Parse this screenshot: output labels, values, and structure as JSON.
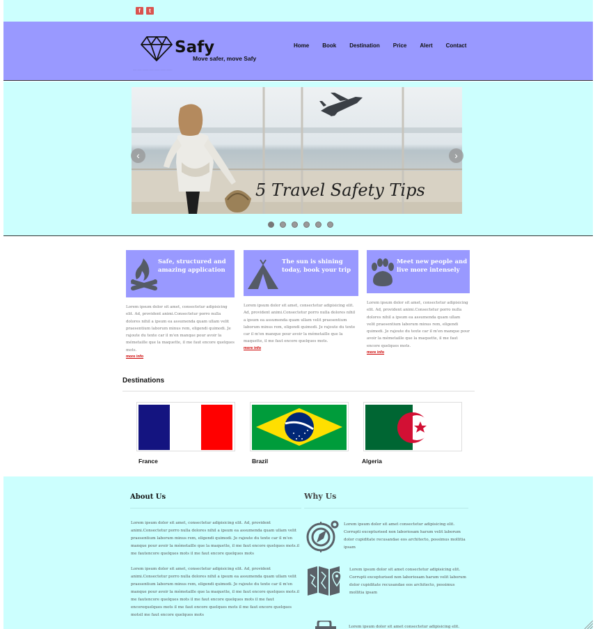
{
  "social": {
    "facebook": "f",
    "twitter": "t"
  },
  "header": {
    "logo": "Safy",
    "tagline": "Move safer, move Safy",
    "tiny_line": "..................................................",
    "nav": [
      "Home",
      "Book",
      "Destination",
      "Price",
      "Alert",
      "Contact"
    ]
  },
  "hero": {
    "slide_text": "5 Travel Safety Tips",
    "slide_count": 6,
    "active_slide": 1
  },
  "features": [
    {
      "icon": "campfire-icon",
      "title": "Safe, structured and amazing application",
      "body": "Lorem ipsum dolor sit amet, consectetur adipisicing elit. Ad, provident animi.Consectetur porro nulla dolores nihil a ipsum ea assumenda quam ullam velit praesentium laborum minus rem, eligendi quimodi. Je rajoute du texte car il m'en manque pour avoir la mémetaille que la maquette, il me faut encore quelques mots.",
      "more": "more info"
    },
    {
      "icon": "tent-icon",
      "title": "The sun is shining today, book your trip",
      "body": "Lorem ipsum dolor sit amet, consectetur adipisicing elit. Ad, provident animi.Consectetur porro nulla dolores nihil a ipsum ea assumenda quam ullam velit praesentium laborum minus rem, eligendi quimodi. Je rajoute du texte car il m'en manque pour avoir la mémetaille que la maquette, il me faut encore quelques mots.",
      "more": "more info"
    },
    {
      "icon": "paw-icon",
      "title": "Meet new people and live more intensely",
      "body": "Lorem ipsum dolor sit amet, consectetur adipisicing elit. Ad, provident animi.Consectetur porro nulla dolores nihil a ipsum ea assumenda quam ullam velit praesentium laborum minus rem, eligendi quimodi. Je rajoute du texte car il m'en manque pour avoir la mémetaille que la maquette, il me faut encore quelques mots.",
      "more": "more info"
    }
  ],
  "destinations": {
    "title": "Destinations",
    "items": [
      "France",
      "Brazil",
      "Algeria"
    ]
  },
  "footer": {
    "about_title": "About Us",
    "about_p1": "Lorem ipsum dolor sit amet, consectetur adipisicing elit. Ad, provident animi.Consectetur porro nulla dolores nihil a ipsum ea assumenda quam ullam velit praesentium laborum minus rem, eligendi quimodi. Je rajoute du texte car il m'en manque pour avoir la mémetaille que la maquette, il me faut encore quelques mots.il me fautencore quelques mots il me faut encore quelques mots",
    "about_p2": "Lorem ipsum dolor sit amet, consectetur adipisicing elit. Ad, provident animi.Consectetur porro nulla dolores nihil a ipsum ea assumenda quam ullam velit praesentium laborum minus rem, eligendi quimodi. Je rajoute du texte car il m'en manque pour avoir la mémetaille que la maquette, il me faut encore quelques mots.il me fautencore quelques mots il me faut encore quelques mots il me faut encorequelques mots il me faut encore quelques mots il me faut encore quelques motsil me faut encore quelques mots",
    "why_title": "Why Us",
    "why_items": [
      {
        "icon": "compass-icon",
        "text": "Lorem ipsum dolor sit amet consectetur adipisicing elit. Corrupti excepturised non laboriosam harum velit laborum dolor cupiditate recusandae eos architecto, possimus mollitia ipsam"
      },
      {
        "icon": "map-icon",
        "text": "Lorem ipsum dolor sit amet consectetur adipisicing elit. Corrupti excepturised non laboriosam harum velit laborum dolor cupiditate recusandae eos architecto, possimus mollitia ipsam"
      },
      {
        "icon": "luggage-icon",
        "text": "Lorem ipsum dolor sit amet consectetur adipisicing elit."
      }
    ]
  },
  "colors": {
    "header": "#9999ff",
    "light_band": "#ccfffe",
    "accent": "#cc0000"
  }
}
